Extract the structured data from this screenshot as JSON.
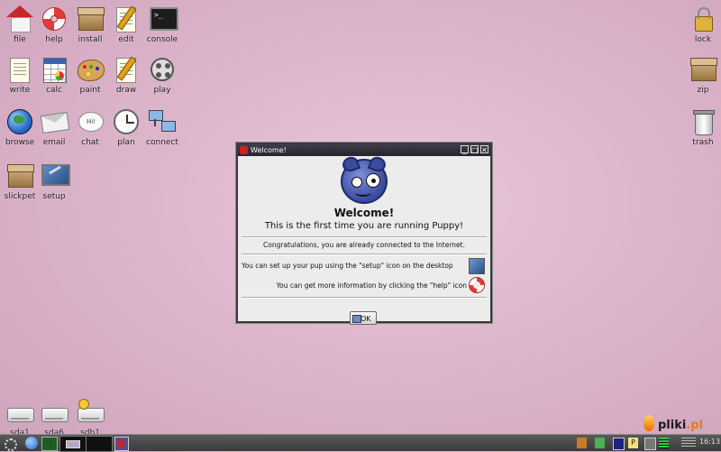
{
  "desktop": {
    "background_color": "#ddb6cc",
    "left_icons": [
      {
        "label": "file",
        "icon": "home-icon"
      },
      {
        "label": "help",
        "icon": "lifebuoy-icon"
      },
      {
        "label": "install",
        "icon": "package-icon"
      },
      {
        "label": "edit",
        "icon": "notepad-icon"
      },
      {
        "label": "console",
        "icon": "terminal-icon"
      },
      {
        "label": "write",
        "icon": "document-icon"
      },
      {
        "label": "calc",
        "icon": "spreadsheet-icon"
      },
      {
        "label": "paint",
        "icon": "palette-icon"
      },
      {
        "label": "draw",
        "icon": "drawing-icon"
      },
      {
        "label": "play",
        "icon": "film-reel-icon"
      },
      {
        "label": "browse",
        "icon": "globe-icon"
      },
      {
        "label": "email",
        "icon": "envelope-icon"
      },
      {
        "label": "chat",
        "icon": "chat-bubble-icon"
      },
      {
        "label": "plan",
        "icon": "clock-icon"
      },
      {
        "label": "connect",
        "icon": "network-icon"
      },
      {
        "label": "slickpet",
        "icon": "package-icon"
      },
      {
        "label": "setup",
        "icon": "monitor-icon"
      }
    ],
    "right_icons": [
      {
        "label": "lock",
        "icon": "padlock-icon"
      },
      {
        "label": "zip",
        "icon": "archive-icon"
      },
      {
        "label": "trash",
        "icon": "trash-icon"
      }
    ],
    "drives": [
      {
        "label": "sda1",
        "icon": "drive-icon"
      },
      {
        "label": "sda6",
        "icon": "drive-icon"
      },
      {
        "label": "sdb1",
        "icon": "usb-drive-icon"
      }
    ]
  },
  "dialog": {
    "window_title": "Welcome!",
    "heading": "Welcome!",
    "subheading": "This is the first time you are running Puppy!",
    "line1": "Congratulations, you are already connected to the Internet.",
    "line2": "You can set up your pup using the \"setup\" icon on the desktop",
    "line3": "You can get more information by clicking the \"help\" icon",
    "ok_label": "OK"
  },
  "taskbar": {
    "clock": "16:13"
  },
  "watermark": {
    "text_main": "pliki",
    "text_dot": ".pl"
  }
}
